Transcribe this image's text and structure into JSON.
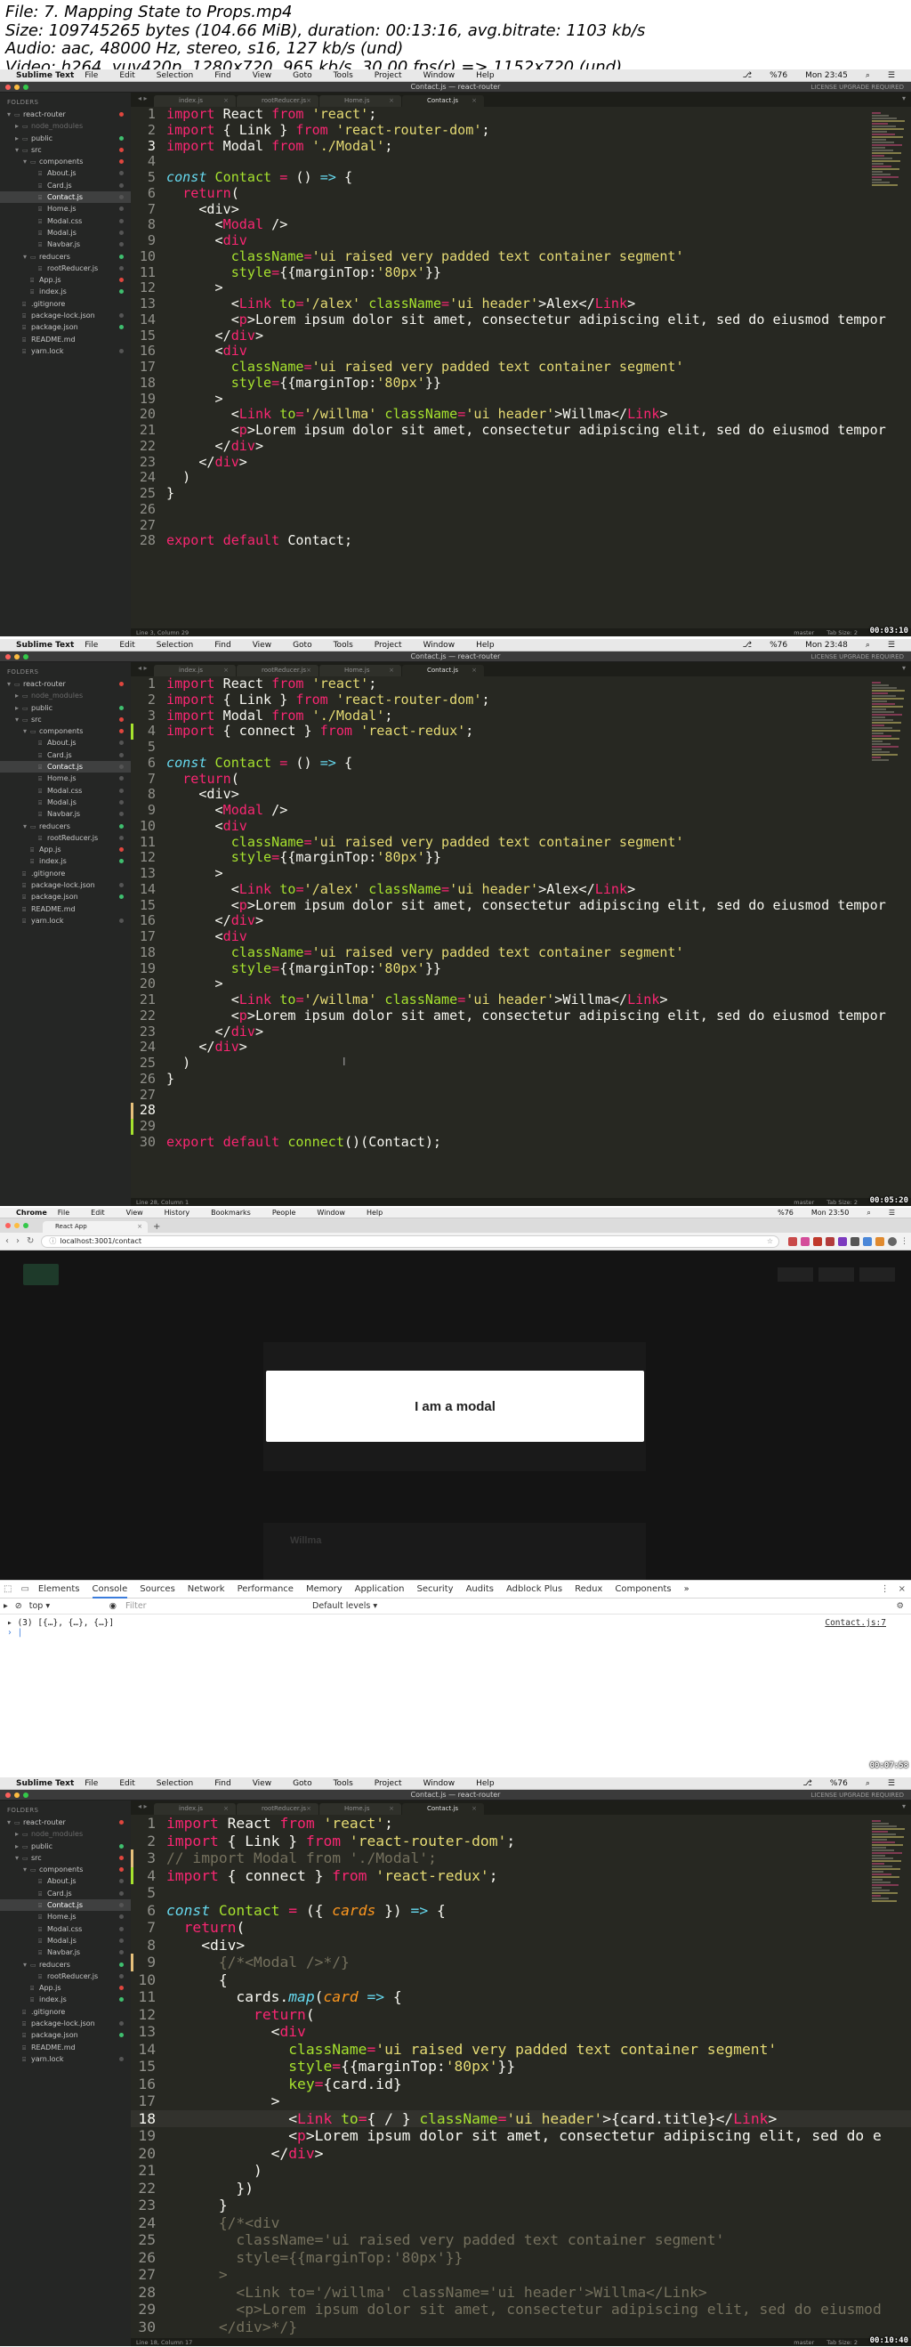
{
  "header": {
    "line1": "File: 7. Mapping State to Props.mp4",
    "line2": "Size: 109745265 bytes (104.66 MiB), duration: 00:13:16, avg.bitrate: 1103 kb/s",
    "line3": "Audio: aac, 48000 Hz, stereo, s16, 127 kb/s (und)",
    "line4": "Video: h264, yuv420p, 1280x720, 965 kb/s, 30.00 fps(r) => 1152x720 (und)"
  },
  "mac_menubar": {
    "app": "Sublime Text",
    "items": [
      "File",
      "Edit",
      "Selection",
      "Find",
      "View",
      "Goto",
      "Tools",
      "Project",
      "Window",
      "Help"
    ],
    "battery": "%76"
  },
  "window_title": "Contact.js — react-router",
  "license_text": "LICENSE UPGRADE REQUIRED",
  "sidebar": {
    "heading": "FOLDERS",
    "items_a": [
      {
        "label": "react-router",
        "indent": 0,
        "type": "folder",
        "open": true,
        "dot": "#e0463e"
      },
      {
        "label": "node_modules",
        "indent": 1,
        "type": "folder",
        "open": false,
        "dim": true
      },
      {
        "label": "public",
        "indent": 1,
        "type": "folder",
        "open": false,
        "dot": "#3fbf6f"
      },
      {
        "label": "src",
        "indent": 1,
        "type": "folder",
        "open": true,
        "dot": "#e0463e"
      },
      {
        "label": "components",
        "indent": 2,
        "type": "folder",
        "open": true,
        "dot": "#e0463e"
      },
      {
        "label": "About.js",
        "indent": 3,
        "type": "file",
        "dot": "#555"
      },
      {
        "label": "Card.js",
        "indent": 3,
        "type": "file",
        "dot": "#555"
      },
      {
        "label": "Contact.js",
        "indent": 3,
        "type": "file",
        "sel": true,
        "dot": "#555"
      },
      {
        "label": "Home.js",
        "indent": 3,
        "type": "file",
        "dot": "#555"
      },
      {
        "label": "Modal.css",
        "indent": 3,
        "type": "file",
        "dot": "#555"
      },
      {
        "label": "Modal.js",
        "indent": 3,
        "type": "file",
        "dot": "#555"
      },
      {
        "label": "Navbar.js",
        "indent": 3,
        "type": "file",
        "dot": "#555"
      },
      {
        "label": "reducers",
        "indent": 2,
        "type": "folder",
        "open": true,
        "dot": "#3fbf6f"
      },
      {
        "label": "rootReducer.js",
        "indent": 3,
        "type": "file",
        "dot": "#555"
      },
      {
        "label": "App.js",
        "indent": 2,
        "type": "file",
        "dot": "#e0463e"
      },
      {
        "label": "index.js",
        "indent": 2,
        "type": "file",
        "dot": "#3fbf6f"
      },
      {
        "label": ".gitignore",
        "indent": 1,
        "type": "file"
      },
      {
        "label": "package-lock.json",
        "indent": 1,
        "type": "file",
        "dot": "#555"
      },
      {
        "label": "package.json",
        "indent": 1,
        "type": "file",
        "dot": "#3fbf6f"
      },
      {
        "label": "README.md",
        "indent": 1,
        "type": "file"
      },
      {
        "label": "yarn.lock",
        "indent": 1,
        "type": "file",
        "dot": "#555"
      }
    ]
  },
  "tabs": [
    "index.js",
    "rootReducer.js",
    "Home.js",
    "Contact.js"
  ],
  "screens": [
    {
      "code": [
        "<k>import</k> React <k>from</k> <s>'react'</s>;",
        "<k>import</k> { Link } <k>from</k> <s>'react-router-dom'</s>;",
        "<k>import</k> Modal <k>from</k> <s>'./Modal'</s>;",
        "",
        "<f>const</f> <g>Contact</g> <k>=</k> () <f>=></f> {",
        "  <k>return</k>(",
        "    <div>",
        "      <<k>Modal</k> />",
        "      <<k>div</k>",
        "        <g>className</g><k>=</k><s>'ui raised very padded text container segment'</s>",
        "        <g>style</g><k>=</k>{{marginTop:<s>'80px'</s>}}",
        "      >",
        "        <<k>Link</k> <g>to</g><k>=</k><s>'/alex'</s> <g>className</g><k>=</k><s>'ui header'</s>>Alex</<k>Link</k>>",
        "        <<k>p</k>>Lorem ipsum dolor sit amet, consectetur adipiscing elit, sed do eiusmod tempor",
        "      </<k>div</k>>",
        "      <<k>div</k>",
        "        <g>className</g><k>=</k><s>'ui raised very padded text container segment'</s>",
        "        <g>style</g><k>=</k>{{marginTop:<s>'80px'</s>}}",
        "      >",
        "        <<k>Link</k> <g>to</g><k>=</k><s>'/willma'</s> <g>className</g><k>=</k><s>'ui header'</s>>Willma</<k>Link</k>>",
        "        <<k>p</k>>Lorem ipsum dolor sit amet, consectetur adipiscing elit, sed do eiusmod tempor",
        "      </<k>div</k>>",
        "    </<k>div</k>>",
        "  )",
        "}",
        "",
        "",
        "<k>export</k> <k>default</k> Contact;"
      ],
      "current_line": 3,
      "status_left": "Line 3, Column 29",
      "branch": "master",
      "tab_size": "Tab Size: 2",
      "timestamp": "00:03:10",
      "clock": "Mon 23:45"
    },
    {
      "code": [
        "<k>import</k> React <k>from</k> <s>'react'</s>;",
        "<k>import</k> { Link } <k>from</k> <s>'react-router-dom'</s>;",
        "<k>import</k> Modal <k>from</k> <s>'./Modal'</s>;",
        "<k>import</k> { connect } <k>from</k> <s>'react-redux'</s>;",
        "",
        "<f>const</f> <g>Contact</g> <k>=</k> () <f>=></f> {",
        "  <k>return</k>(",
        "    <div>",
        "      <<k>Modal</k> />",
        "      <<k>div</k>",
        "        <g>className</g><k>=</k><s>'ui raised very padded text container segment'</s>",
        "        <g>style</g><k>=</k>{{marginTop:<s>'80px'</s>}}",
        "      >",
        "        <<k>Link</k> <g>to</g><k>=</k><s>'/alex'</s> <g>className</g><k>=</k><s>'ui header'</s>>Alex</<k>Link</k>>",
        "        <<k>p</k>>Lorem ipsum dolor sit amet, consectetur adipiscing elit, sed do eiusmod tempor",
        "      </<k>div</k>>",
        "      <<k>div</k>",
        "        <g>className</g><k>=</k><s>'ui raised very padded text container segment'</s>",
        "        <g>style</g><k>=</k>{{marginTop:<s>'80px'</s>}}",
        "      >",
        "        <<k>Link</k> <g>to</g><k>=</k><s>'/willma'</s> <g>className</g><k>=</k><s>'ui header'</s>>Willma</<k>Link</k>>",
        "        <<k>p</k>>Lorem ipsum dolor sit amet, consectetur adipiscing elit, sed do eiusmod tempor",
        "      </<k>div</k>>",
        "    </<k>div</k>>",
        "  )",
        "}",
        "",
        "",
        "",
        "<k>export</k> <k>default</k> <g>connect</g>()(Contact);"
      ],
      "current_line": 28,
      "status_left": "Line 28, Column 1",
      "branch": "master",
      "tab_size": "Tab Size: 2",
      "timestamp": "00:05:20",
      "clock": "Mon 23:48"
    },
    {
      "code": [
        "<k>import</k> React <k>from</k> <s>'react'</s>;",
        "<k>import</k> { Link } <k>from</k> <s>'react-router-dom'</s>;",
        "<c>// import Modal from './Modal';</c>",
        "<k>import</k> { connect } <k>from</k> <s>'react-redux'</s>;",
        "",
        "<f>const</f> <g>Contact</g> <k>=</k> ({ <p>cards</p> }) <f>=></f> {",
        "  <k>return</k>(",
        "    <div>",
        "      <c>{/*<Modal />*/}</c>",
        "      {",
        "        cards.<f>map</f>(<p>card</p> <f>=></f> {",
        "          <k>return</k>(",
        "            <<k>div</k>",
        "              <g>className</g><k>=</k><s>'ui raised very padded text container segment'</s>",
        "              <g>style</g><k>=</k>{{marginTop:<s>'80px'</s>}}",
        "              <g>key</g><k>=</k>{card.id}",
        "            >",
        "              <<k>Link</k> <g>to</g><k>=</k>{ / } <g>className</g><k>=</k><s>'ui header'</s>>{card.title}</<k>Link</k>>",
        "              <<k>p</k>>Lorem ipsum dolor sit amet, consectetur adipiscing elit, sed do e",
        "            </<k>div</k>>",
        "          )",
        "        })",
        "      }",
        "      <c>{/*<div</c>",
        "        <c>className='ui raised very padded text container segment'</c>",
        "        <c>style={{marginTop:'80px'}}</c>",
        "      <c>></c>",
        "        <c><Link to='/willma' className='ui header'>Willma</Link></c>",
        "        <c><p>Lorem ipsum dolor sit amet, consectetur adipiscing elit, sed do eiusmod</c>",
        "      <c></div>*/}</c>",
        "    </<k>div</k>>"
      ],
      "current_line": 18,
      "status_left": "Line 18, Column 17",
      "branch": "master",
      "tab_size": "Tab Size: 2",
      "timestamp": "00:10:40"
    }
  ],
  "chrome": {
    "menubar_app": "Chrome",
    "menubar_items": [
      "File",
      "Edit",
      "View",
      "History",
      "Bookmarks",
      "People",
      "Window",
      "Help"
    ],
    "clock": "Mon 23:50",
    "tab_title": "React App",
    "url": "localhost:3001/contact",
    "modal_text": "I am a modal",
    "page_faint_text": "Willma",
    "devtools_tabs": [
      "Elements",
      "Console",
      "Sources",
      "Network",
      "Performance",
      "Memory",
      "Application",
      "Security",
      "Audits",
      "Adblock Plus",
      "Redux",
      "Components"
    ],
    "devtools_active": "Console",
    "context": "top",
    "filter_placeholder": "Filter",
    "levels": "Default levels",
    "console_line": "▸ (3) [{…}, {…}, {…}]",
    "console_source": "Contact.js:7",
    "timestamp": "00:07:58"
  }
}
